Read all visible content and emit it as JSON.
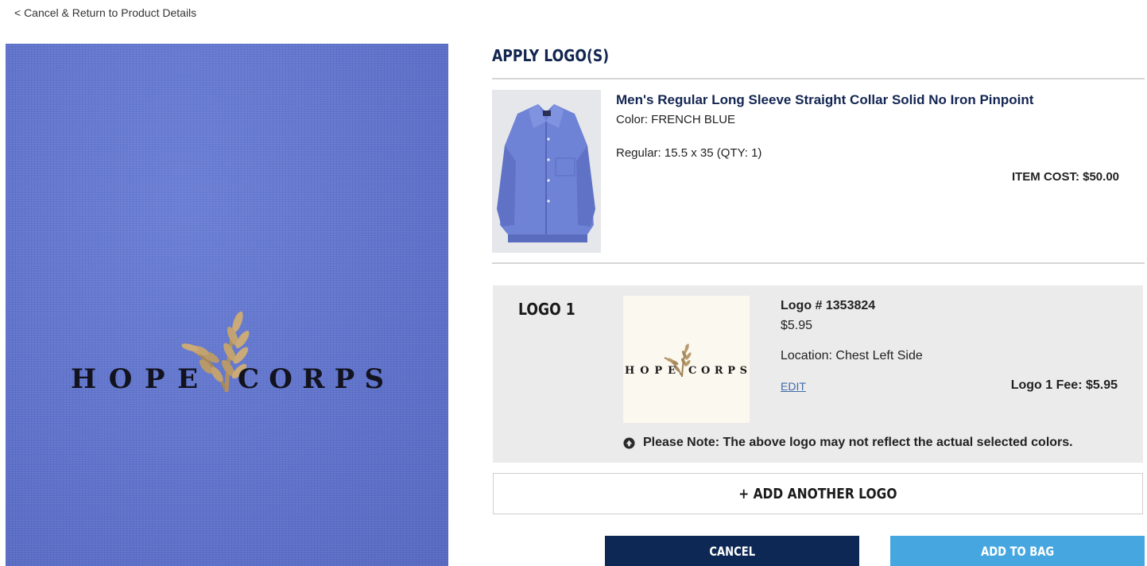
{
  "nav": {
    "back_link": "< Cancel & Return to Product Details"
  },
  "preview": {
    "logo_left_word": "HOPE",
    "logo_right_word": "CORPS"
  },
  "section": {
    "title": "APPLY LOGO(S)"
  },
  "product": {
    "name": "Men's Regular Long Sleeve Straight Collar Solid No Iron Pinpoint",
    "color": "Color: FRENCH BLUE",
    "size_qty": "Regular: 15.5 x 35 (QTY: 1)",
    "item_cost": "ITEM COST: $50.00"
  },
  "logo_item": {
    "title": "LOGO 1",
    "thumb_left_word": "HOPE",
    "thumb_right_word": "CORPS",
    "number": "Logo # 1353824",
    "price": "$5.95",
    "location": "Location: Chest Left Side",
    "edit_label": "EDIT",
    "fee": "Logo 1 Fee: $5.95",
    "note": "Please Note: The above logo may not reflect the actual selected colors."
  },
  "actions": {
    "add_another_logo": "+ ADD ANOTHER LOGO",
    "cancel": "CANCEL",
    "add_to_bag": "ADD TO BAG"
  },
  "colors": {
    "navy": "#0d2854",
    "light_blue": "#46a7e0",
    "shirt_blue": "#6377cf"
  },
  "icons": {
    "note": "circle-arrow-up-icon",
    "logo_mark": "wheat-icon"
  }
}
